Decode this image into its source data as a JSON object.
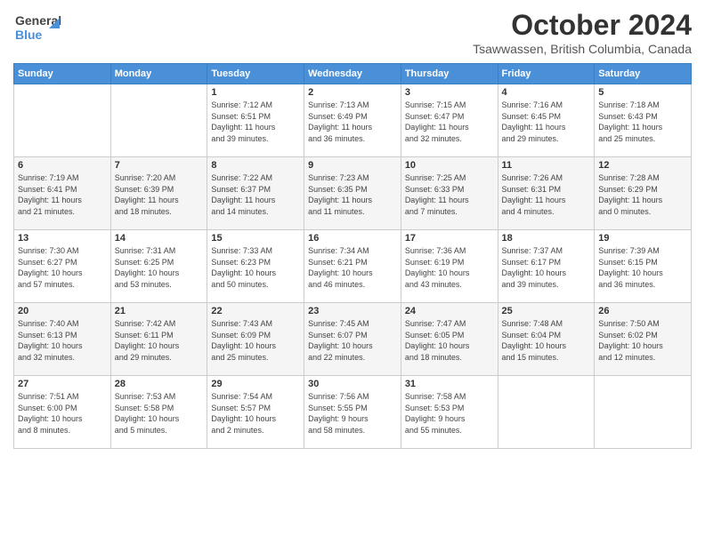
{
  "logo": {
    "line1": "General",
    "line2": "Blue",
    "arrow": "▶"
  },
  "title": "October 2024",
  "subtitle": "Tsawwassen, British Columbia, Canada",
  "weekdays": [
    "Sunday",
    "Monday",
    "Tuesday",
    "Wednesday",
    "Thursday",
    "Friday",
    "Saturday"
  ],
  "weeks": [
    [
      {
        "day": "",
        "info": ""
      },
      {
        "day": "",
        "info": ""
      },
      {
        "day": "1",
        "info": "Sunrise: 7:12 AM\nSunset: 6:51 PM\nDaylight: 11 hours\nand 39 minutes."
      },
      {
        "day": "2",
        "info": "Sunrise: 7:13 AM\nSunset: 6:49 PM\nDaylight: 11 hours\nand 36 minutes."
      },
      {
        "day": "3",
        "info": "Sunrise: 7:15 AM\nSunset: 6:47 PM\nDaylight: 11 hours\nand 32 minutes."
      },
      {
        "day": "4",
        "info": "Sunrise: 7:16 AM\nSunset: 6:45 PM\nDaylight: 11 hours\nand 29 minutes."
      },
      {
        "day": "5",
        "info": "Sunrise: 7:18 AM\nSunset: 6:43 PM\nDaylight: 11 hours\nand 25 minutes."
      }
    ],
    [
      {
        "day": "6",
        "info": "Sunrise: 7:19 AM\nSunset: 6:41 PM\nDaylight: 11 hours\nand 21 minutes."
      },
      {
        "day": "7",
        "info": "Sunrise: 7:20 AM\nSunset: 6:39 PM\nDaylight: 11 hours\nand 18 minutes."
      },
      {
        "day": "8",
        "info": "Sunrise: 7:22 AM\nSunset: 6:37 PM\nDaylight: 11 hours\nand 14 minutes."
      },
      {
        "day": "9",
        "info": "Sunrise: 7:23 AM\nSunset: 6:35 PM\nDaylight: 11 hours\nand 11 minutes."
      },
      {
        "day": "10",
        "info": "Sunrise: 7:25 AM\nSunset: 6:33 PM\nDaylight: 11 hours\nand 7 minutes."
      },
      {
        "day": "11",
        "info": "Sunrise: 7:26 AM\nSunset: 6:31 PM\nDaylight: 11 hours\nand 4 minutes."
      },
      {
        "day": "12",
        "info": "Sunrise: 7:28 AM\nSunset: 6:29 PM\nDaylight: 11 hours\nand 0 minutes."
      }
    ],
    [
      {
        "day": "13",
        "info": "Sunrise: 7:30 AM\nSunset: 6:27 PM\nDaylight: 10 hours\nand 57 minutes."
      },
      {
        "day": "14",
        "info": "Sunrise: 7:31 AM\nSunset: 6:25 PM\nDaylight: 10 hours\nand 53 minutes."
      },
      {
        "day": "15",
        "info": "Sunrise: 7:33 AM\nSunset: 6:23 PM\nDaylight: 10 hours\nand 50 minutes."
      },
      {
        "day": "16",
        "info": "Sunrise: 7:34 AM\nSunset: 6:21 PM\nDaylight: 10 hours\nand 46 minutes."
      },
      {
        "day": "17",
        "info": "Sunrise: 7:36 AM\nSunset: 6:19 PM\nDaylight: 10 hours\nand 43 minutes."
      },
      {
        "day": "18",
        "info": "Sunrise: 7:37 AM\nSunset: 6:17 PM\nDaylight: 10 hours\nand 39 minutes."
      },
      {
        "day": "19",
        "info": "Sunrise: 7:39 AM\nSunset: 6:15 PM\nDaylight: 10 hours\nand 36 minutes."
      }
    ],
    [
      {
        "day": "20",
        "info": "Sunrise: 7:40 AM\nSunset: 6:13 PM\nDaylight: 10 hours\nand 32 minutes."
      },
      {
        "day": "21",
        "info": "Sunrise: 7:42 AM\nSunset: 6:11 PM\nDaylight: 10 hours\nand 29 minutes."
      },
      {
        "day": "22",
        "info": "Sunrise: 7:43 AM\nSunset: 6:09 PM\nDaylight: 10 hours\nand 25 minutes."
      },
      {
        "day": "23",
        "info": "Sunrise: 7:45 AM\nSunset: 6:07 PM\nDaylight: 10 hours\nand 22 minutes."
      },
      {
        "day": "24",
        "info": "Sunrise: 7:47 AM\nSunset: 6:05 PM\nDaylight: 10 hours\nand 18 minutes."
      },
      {
        "day": "25",
        "info": "Sunrise: 7:48 AM\nSunset: 6:04 PM\nDaylight: 10 hours\nand 15 minutes."
      },
      {
        "day": "26",
        "info": "Sunrise: 7:50 AM\nSunset: 6:02 PM\nDaylight: 10 hours\nand 12 minutes."
      }
    ],
    [
      {
        "day": "27",
        "info": "Sunrise: 7:51 AM\nSunset: 6:00 PM\nDaylight: 10 hours\nand 8 minutes."
      },
      {
        "day": "28",
        "info": "Sunrise: 7:53 AM\nSunset: 5:58 PM\nDaylight: 10 hours\nand 5 minutes."
      },
      {
        "day": "29",
        "info": "Sunrise: 7:54 AM\nSunset: 5:57 PM\nDaylight: 10 hours\nand 2 minutes."
      },
      {
        "day": "30",
        "info": "Sunrise: 7:56 AM\nSunset: 5:55 PM\nDaylight: 9 hours\nand 58 minutes."
      },
      {
        "day": "31",
        "info": "Sunrise: 7:58 AM\nSunset: 5:53 PM\nDaylight: 9 hours\nand 55 minutes."
      },
      {
        "day": "",
        "info": ""
      },
      {
        "day": "",
        "info": ""
      }
    ]
  ]
}
